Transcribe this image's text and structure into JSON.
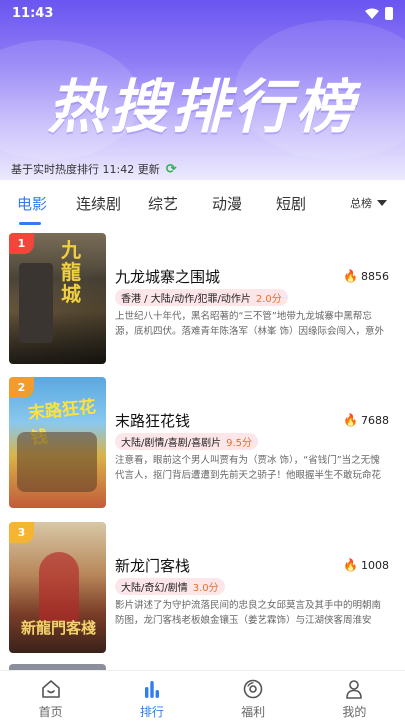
{
  "status_bar": {
    "time": "11:43"
  },
  "banner": {
    "title": "热搜排行榜"
  },
  "update_text": "基于实时热度排行 11:42 更新",
  "tabs": [
    {
      "label": "电影"
    },
    {
      "label": "连续剧"
    },
    {
      "label": "综艺"
    },
    {
      "label": "动漫"
    },
    {
      "label": "短剧"
    }
  ],
  "sort_label": "总榜",
  "movies": [
    {
      "rank": "1",
      "title": "九龙城寨之围城",
      "heat": "8856",
      "genre": "香港 / 大陆/动作/犯罪/动作片",
      "score": "2.0分",
      "desc": "上世纪八十年代，黑名昭著的“三不管”地带九龙城寨中黑帮忘源，底机四伏。落难青年陈洛军（林峯 饰）因缘际会闯入，意外被“大人物”龙卷风（古天乐 饰）搭救，更结下真挚兄弟情义。与此同时，琼躏城..."
    },
    {
      "rank": "2",
      "title": "末路狂花钱",
      "heat": "7688",
      "genre": "大陆/剧情/喜剧/喜剧片",
      "score": "9.5分",
      "desc": "注意看，眼前这个男人叫贾有为（贾冰 饰），“省钱门”当之无愧代言人，抠门背后遭遭到先前天之骄子！他眼握半生不敢玩命花钱，没成想正值叶年带患绝症竟没命花钱！眼看生命只剩十天，百万存款秒..."
    },
    {
      "rank": "3",
      "title": "新龙门客栈",
      "heat": "1008",
      "genre": "大陆/奇幻/剧情",
      "score": "3.0分",
      "desc": "影片讲述了为守护流落民间的忠良之女邱莫言及其手中的明朝南防图，龙门客栈老板娘金镶玉（姜艺霖饰）与江湖侠客周淮安（梁森饰）结盟，二人联手与神秘而强大的侯府僵僵师（陈志朋饰）和前..."
    }
  ],
  "bottom_nav": [
    {
      "label": "首页"
    },
    {
      "label": "排行"
    },
    {
      "label": "福利"
    },
    {
      "label": "我的"
    }
  ],
  "colors": {
    "accent": "#2f7df0",
    "fire": "#f0382b",
    "score": "#e2702c",
    "tag_bg": "#fde6ea"
  }
}
